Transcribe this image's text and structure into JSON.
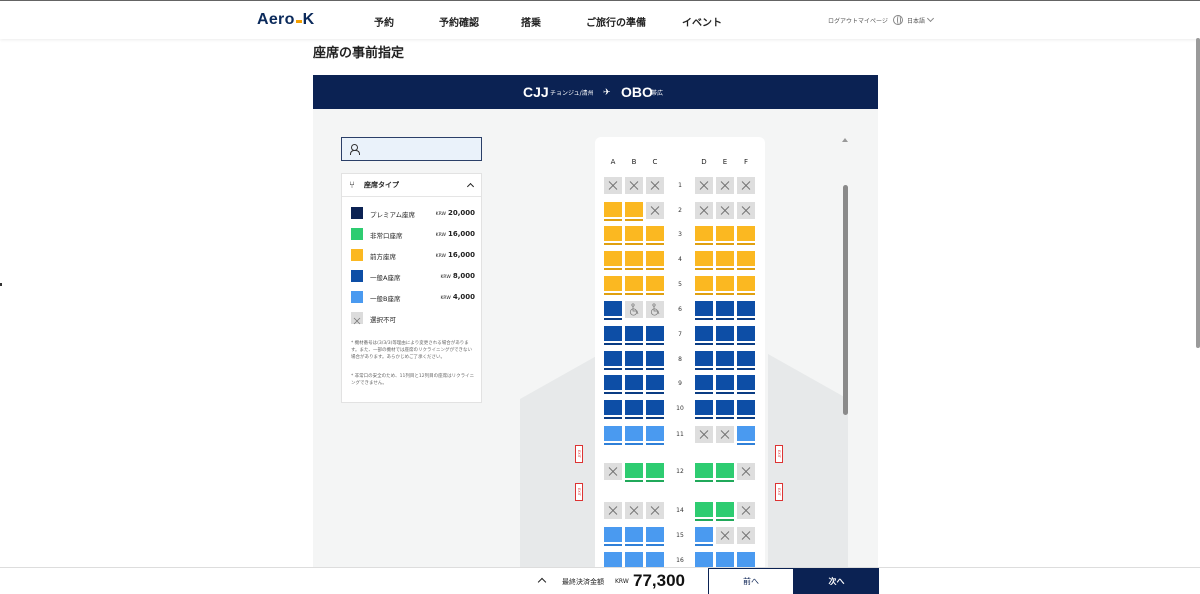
{
  "header": {
    "logo_left": "Aero",
    "logo_right": "K",
    "nav": [
      "予約",
      "予約確認",
      "搭乗",
      "ご旅行の準備",
      "イベント"
    ],
    "utility": [
      "ログアウト",
      "マイページ"
    ],
    "language": "日本語"
  },
  "page_title": "座席の事前指定",
  "route": {
    "from_code": "CJJ",
    "from_city": "チョンジュ/清州",
    "plane_icon": "airplane-icon",
    "to_code": "OBO",
    "to_city": "帯広"
  },
  "search": {
    "placeholder": "",
    "icon": "user-icon"
  },
  "legend": {
    "title": "座席タイプ",
    "items": [
      {
        "name": "プレミアム座席",
        "currency": "KRW",
        "price": "20,000",
        "color": "#0b2253"
      },
      {
        "name": "非常口座席",
        "currency": "KRW",
        "price": "16,000",
        "color": "#2ecc71"
      },
      {
        "name": "前方座席",
        "currency": "KRW",
        "price": "16,000",
        "color": "#fbb821"
      },
      {
        "name": "一般A座席",
        "currency": "KRW",
        "price": "8,000",
        "color": "#0d4ea6"
      },
      {
        "name": "一般B座席",
        "currency": "KRW",
        "price": "4,000",
        "color": "#4a9af0"
      },
      {
        "name": "選択不可",
        "currency": "",
        "price": "",
        "color": "#dcdcdc"
      }
    ],
    "notes": [
      "* 機材番号は(3/3/3)等理由により変更される場合があります。また、一部の機材では座席のリクライニングができない場合があります。あらかじめご了承ください。",
      "* 非常口の安全のため、11列目と12列目の座席はリクライニングできません。"
    ]
  },
  "seatmap": {
    "columns": [
      "A",
      "B",
      "C",
      "D",
      "E",
      "F"
    ],
    "exit_label": "EXIT",
    "rows": [
      {
        "num": "1",
        "seats": [
          "x",
          "x",
          "x",
          "x",
          "x",
          "x"
        ]
      },
      {
        "num": "2",
        "seats": [
          "front",
          "front",
          "x",
          "x",
          "x",
          "x"
        ]
      },
      {
        "num": "3",
        "seats": [
          "front",
          "front",
          "front",
          "front",
          "front",
          "front"
        ]
      },
      {
        "num": "4",
        "seats": [
          "front",
          "front",
          "front",
          "front",
          "front",
          "front"
        ]
      },
      {
        "num": "5",
        "seats": [
          "front",
          "front",
          "front",
          "front",
          "front",
          "front"
        ]
      },
      {
        "num": "6",
        "seats": [
          "genA",
          "wheel",
          "wheel",
          "genA",
          "genA",
          "genA"
        ]
      },
      {
        "num": "7",
        "seats": [
          "genA",
          "genA",
          "genA",
          "genA",
          "genA",
          "genA"
        ]
      },
      {
        "num": "8",
        "seats": [
          "genA",
          "genA",
          "genA",
          "genA",
          "genA",
          "genA"
        ]
      },
      {
        "num": "9",
        "seats": [
          "genA",
          "genA",
          "genA",
          "genA",
          "genA",
          "genA"
        ]
      },
      {
        "num": "10",
        "seats": [
          "genA",
          "genA",
          "genA",
          "genA",
          "genA",
          "genA"
        ]
      },
      {
        "num": "11",
        "seats": [
          "genB",
          "genB",
          "genB",
          "x",
          "x",
          "genB"
        ]
      },
      {
        "num": "12",
        "seats": [
          "x",
          "exit",
          "exit",
          "exit",
          "exit",
          "x"
        ]
      },
      {
        "num": "14",
        "seats": [
          "x",
          "x",
          "x",
          "exit",
          "exit",
          "x"
        ]
      },
      {
        "num": "15",
        "seats": [
          "genB",
          "genB",
          "genB",
          "genB",
          "x",
          "x"
        ]
      },
      {
        "num": "16",
        "seats": [
          "genB",
          "genB",
          "genB",
          "genB",
          "genB",
          "genB"
        ]
      }
    ]
  },
  "footer": {
    "label": "最終決済金額",
    "currency": "KRW",
    "total": "77,300",
    "prev": "前へ",
    "next": "次へ"
  }
}
